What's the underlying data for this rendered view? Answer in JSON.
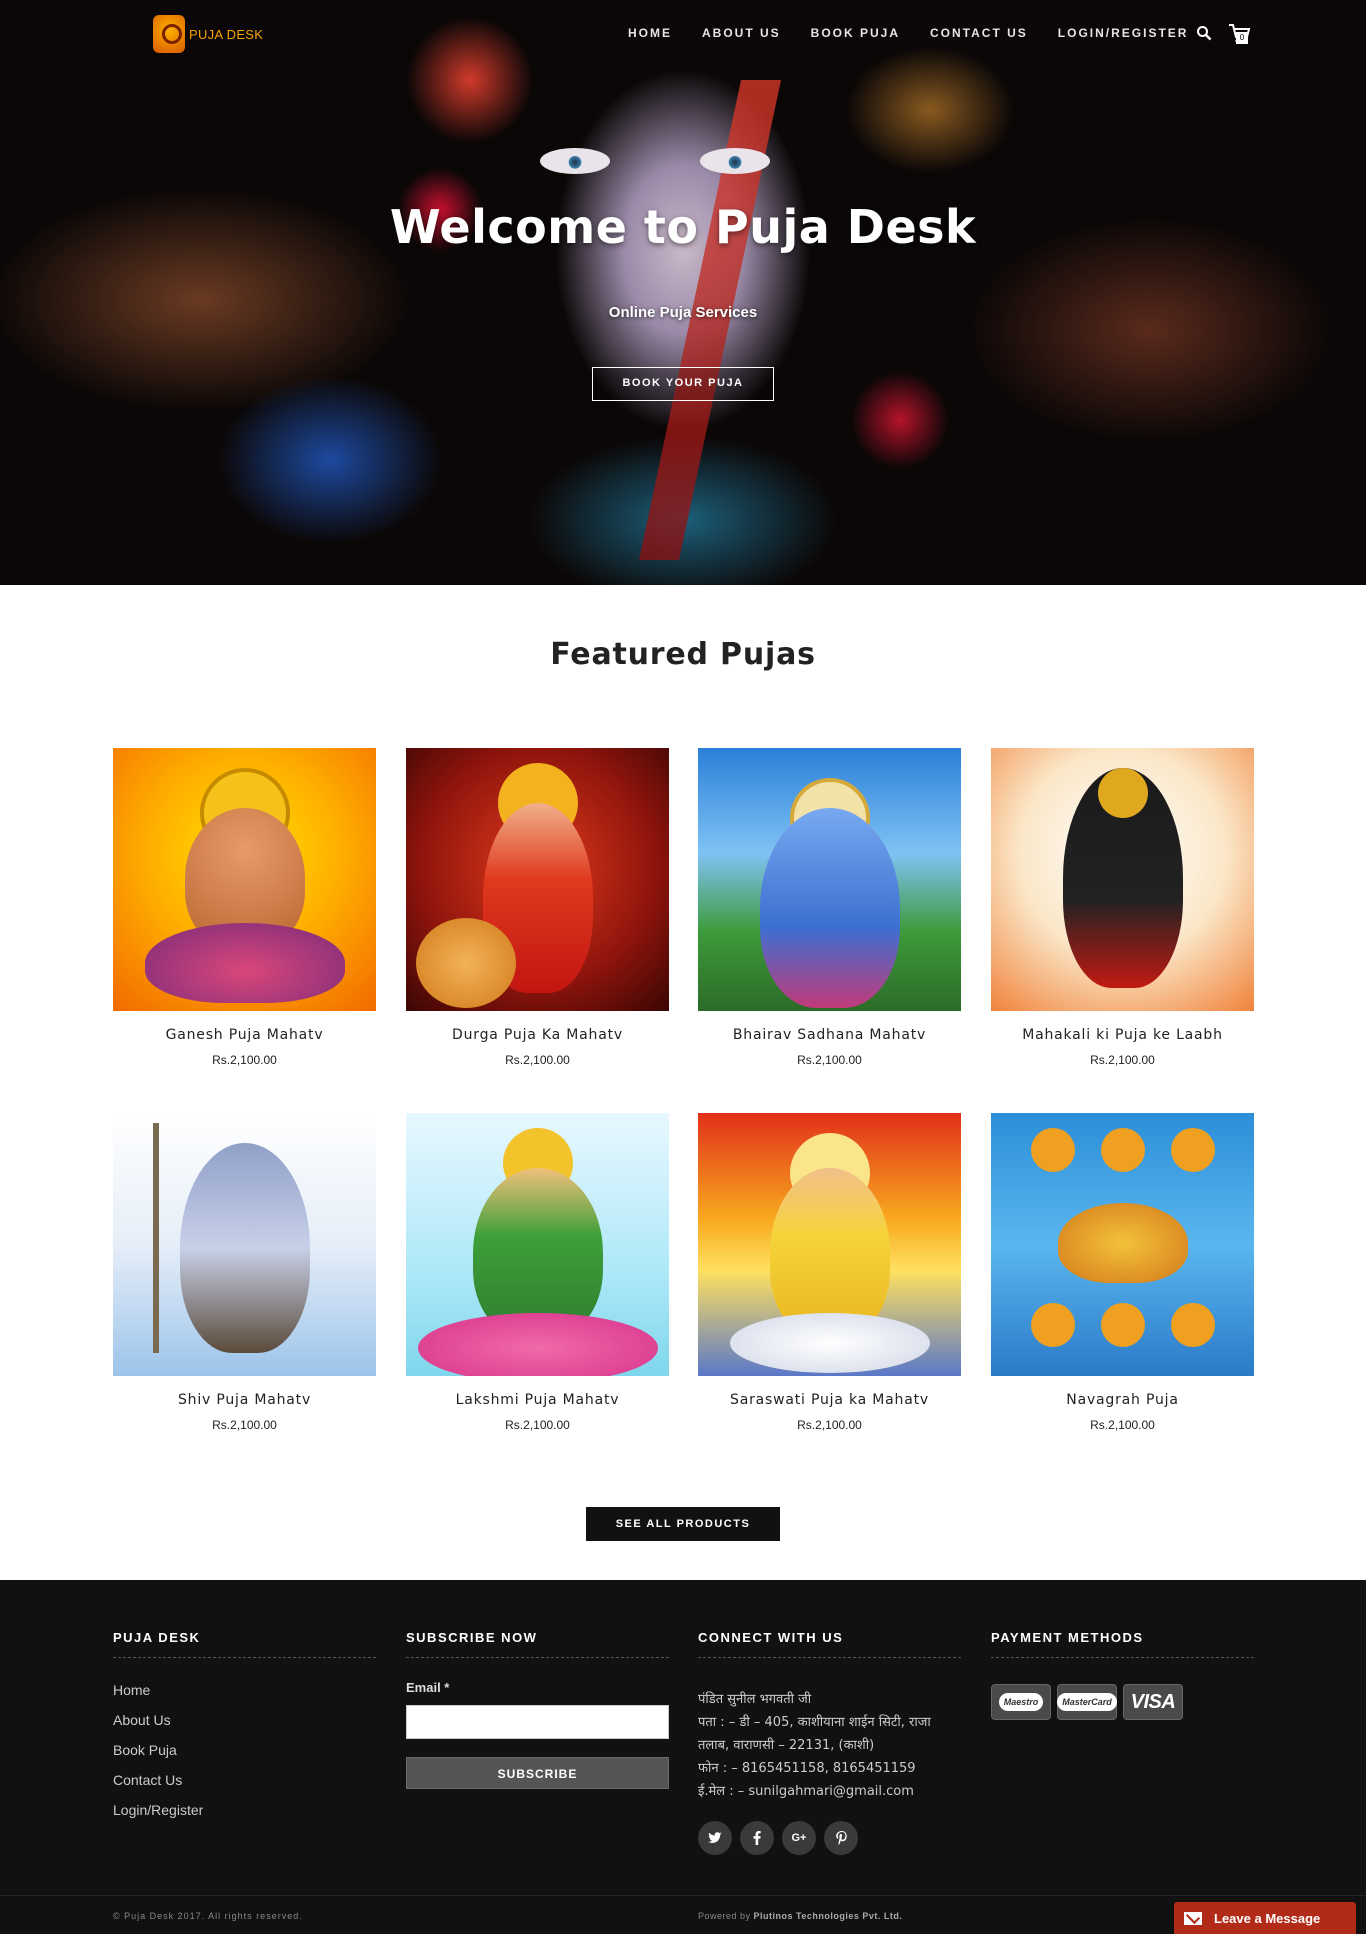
{
  "header": {
    "logo_text": "PUJA DESK",
    "nav": [
      "HOME",
      "ABOUT US",
      "BOOK PUJA",
      "CONTACT US",
      "LOGIN/REGISTER"
    ],
    "cart_count": "0",
    "icons": [
      "search-icon",
      "cart-icon"
    ]
  },
  "hero": {
    "title": "Welcome to Puja Desk",
    "subtitle": "Online Puja Services",
    "button": "BOOK YOUR PUJA"
  },
  "featured": {
    "title": "Featured Pujas",
    "products": [
      {
        "name": "Ganesh Puja Mahatv",
        "price": "Rs.2,100.00"
      },
      {
        "name": "Durga Puja Ka Mahatv",
        "price": "Rs.2,100.00"
      },
      {
        "name": "Bhairav Sadhana Mahatv",
        "price": "Rs.2,100.00"
      },
      {
        "name": "Mahakali ki Puja ke Laabh",
        "price": "Rs.2,100.00"
      },
      {
        "name": "Shiv Puja Mahatv",
        "price": "Rs.2,100.00"
      },
      {
        "name": "Lakshmi Puja Mahatv",
        "price": "Rs.2,100.00"
      },
      {
        "name": "Saraswati Puja ka Mahatv",
        "price": "Rs.2,100.00"
      },
      {
        "name": "Navagrah Puja",
        "price": "Rs.2,100.00"
      }
    ],
    "see_all": "SEE ALL PRODUCTS"
  },
  "footer": {
    "col1": {
      "heading": "PUJA DESK",
      "links": [
        "Home",
        "About Us",
        "Book Puja",
        "Contact Us",
        "Login/Register"
      ]
    },
    "col2": {
      "heading": "SUBSCRIBE NOW",
      "email_label": "Email *",
      "email_value": "",
      "button": "SUBSCRIBE"
    },
    "col3": {
      "heading": "CONNECT WITH US",
      "lines": [
        "पंडित सुनील भगवती जी",
        "पता : – डी – 405, काशीयाना शाईन सिटी, राजा",
        "तलाब, वाराणसी – 22131, (काशी)",
        "फोन : – 8165451158, 8165451159",
        "ई.मेल : – sunilgahmari@gmail.com"
      ],
      "socials": [
        "twitter-icon",
        "facebook-icon",
        "google-plus-icon",
        "pinterest-icon"
      ]
    },
    "col4": {
      "heading": "PAYMENT METHODS",
      "cards": [
        "Maestro",
        "MasterCard",
        "VISA"
      ]
    },
    "copyright": "© Puja Desk 2017. All rights reserved.",
    "powered_prefix": "Powered by",
    "powered_company": "Plutinos Technologies Pvt. Ltd.",
    "chat": "Leave a Message"
  },
  "colors": {
    "accent": "#f7a400",
    "footer_bg": "#111111",
    "chat_bg": "#b22a18"
  }
}
